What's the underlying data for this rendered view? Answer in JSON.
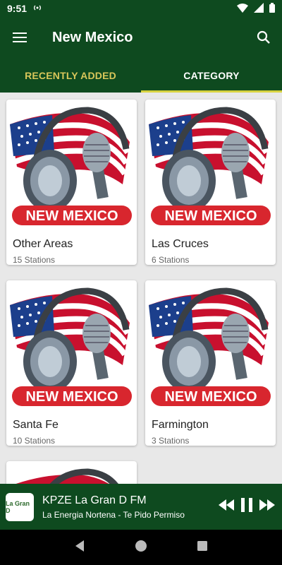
{
  "status": {
    "time": "9:51"
  },
  "app_bar": {
    "title": "New Mexico"
  },
  "tabs": [
    {
      "label": "RECENTLY ADDED",
      "active": false
    },
    {
      "label": "CATEGORY",
      "active": true
    }
  ],
  "categories": [
    {
      "name": "Other Areas",
      "count": "15 Stations",
      "banner": "NEW MEXICO"
    },
    {
      "name": "Las Cruces",
      "count": "6 Stations",
      "banner": "NEW MEXICO"
    },
    {
      "name": "Santa Fe",
      "count": "10 Stations",
      "banner": "NEW MEXICO"
    },
    {
      "name": "Farmington",
      "count": "3 Stations",
      "banner": "NEW MEXICO"
    }
  ],
  "player": {
    "logo_text": "La Gran D",
    "station": "KPZE La Gran D FM",
    "song": "La Energia Nortena - Te Pido Permiso"
  },
  "colors": {
    "primary": "#0e4a1f",
    "tab_indicator": "#d7d341",
    "inactive_tab": "#d8c65a",
    "banner_red": "#d8262e"
  }
}
